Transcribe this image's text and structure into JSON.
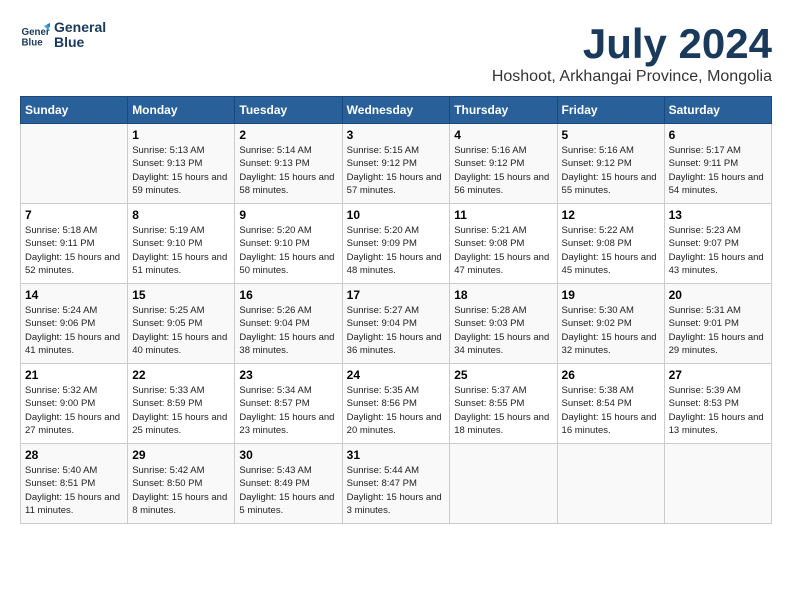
{
  "header": {
    "logo_line1": "General",
    "logo_line2": "Blue",
    "month_year": "July 2024",
    "location": "Hoshoot, Arkhangai Province, Mongolia"
  },
  "weekdays": [
    "Sunday",
    "Monday",
    "Tuesday",
    "Wednesday",
    "Thursday",
    "Friday",
    "Saturday"
  ],
  "weeks": [
    [
      {
        "day": "",
        "info": ""
      },
      {
        "day": "1",
        "info": "Sunrise: 5:13 AM\nSunset: 9:13 PM\nDaylight: 15 hours\nand 59 minutes."
      },
      {
        "day": "2",
        "info": "Sunrise: 5:14 AM\nSunset: 9:13 PM\nDaylight: 15 hours\nand 58 minutes."
      },
      {
        "day": "3",
        "info": "Sunrise: 5:15 AM\nSunset: 9:12 PM\nDaylight: 15 hours\nand 57 minutes."
      },
      {
        "day": "4",
        "info": "Sunrise: 5:16 AM\nSunset: 9:12 PM\nDaylight: 15 hours\nand 56 minutes."
      },
      {
        "day": "5",
        "info": "Sunrise: 5:16 AM\nSunset: 9:12 PM\nDaylight: 15 hours\nand 55 minutes."
      },
      {
        "day": "6",
        "info": "Sunrise: 5:17 AM\nSunset: 9:11 PM\nDaylight: 15 hours\nand 54 minutes."
      }
    ],
    [
      {
        "day": "7",
        "info": "Sunrise: 5:18 AM\nSunset: 9:11 PM\nDaylight: 15 hours\nand 52 minutes."
      },
      {
        "day": "8",
        "info": "Sunrise: 5:19 AM\nSunset: 9:10 PM\nDaylight: 15 hours\nand 51 minutes."
      },
      {
        "day": "9",
        "info": "Sunrise: 5:20 AM\nSunset: 9:10 PM\nDaylight: 15 hours\nand 50 minutes."
      },
      {
        "day": "10",
        "info": "Sunrise: 5:20 AM\nSunset: 9:09 PM\nDaylight: 15 hours\nand 48 minutes."
      },
      {
        "day": "11",
        "info": "Sunrise: 5:21 AM\nSunset: 9:08 PM\nDaylight: 15 hours\nand 47 minutes."
      },
      {
        "day": "12",
        "info": "Sunrise: 5:22 AM\nSunset: 9:08 PM\nDaylight: 15 hours\nand 45 minutes."
      },
      {
        "day": "13",
        "info": "Sunrise: 5:23 AM\nSunset: 9:07 PM\nDaylight: 15 hours\nand 43 minutes."
      }
    ],
    [
      {
        "day": "14",
        "info": "Sunrise: 5:24 AM\nSunset: 9:06 PM\nDaylight: 15 hours\nand 41 minutes."
      },
      {
        "day": "15",
        "info": "Sunrise: 5:25 AM\nSunset: 9:05 PM\nDaylight: 15 hours\nand 40 minutes."
      },
      {
        "day": "16",
        "info": "Sunrise: 5:26 AM\nSunset: 9:04 PM\nDaylight: 15 hours\nand 38 minutes."
      },
      {
        "day": "17",
        "info": "Sunrise: 5:27 AM\nSunset: 9:04 PM\nDaylight: 15 hours\nand 36 minutes."
      },
      {
        "day": "18",
        "info": "Sunrise: 5:28 AM\nSunset: 9:03 PM\nDaylight: 15 hours\nand 34 minutes."
      },
      {
        "day": "19",
        "info": "Sunrise: 5:30 AM\nSunset: 9:02 PM\nDaylight: 15 hours\nand 32 minutes."
      },
      {
        "day": "20",
        "info": "Sunrise: 5:31 AM\nSunset: 9:01 PM\nDaylight: 15 hours\nand 29 minutes."
      }
    ],
    [
      {
        "day": "21",
        "info": "Sunrise: 5:32 AM\nSunset: 9:00 PM\nDaylight: 15 hours\nand 27 minutes."
      },
      {
        "day": "22",
        "info": "Sunrise: 5:33 AM\nSunset: 8:59 PM\nDaylight: 15 hours\nand 25 minutes."
      },
      {
        "day": "23",
        "info": "Sunrise: 5:34 AM\nSunset: 8:57 PM\nDaylight: 15 hours\nand 23 minutes."
      },
      {
        "day": "24",
        "info": "Sunrise: 5:35 AM\nSunset: 8:56 PM\nDaylight: 15 hours\nand 20 minutes."
      },
      {
        "day": "25",
        "info": "Sunrise: 5:37 AM\nSunset: 8:55 PM\nDaylight: 15 hours\nand 18 minutes."
      },
      {
        "day": "26",
        "info": "Sunrise: 5:38 AM\nSunset: 8:54 PM\nDaylight: 15 hours\nand 16 minutes."
      },
      {
        "day": "27",
        "info": "Sunrise: 5:39 AM\nSunset: 8:53 PM\nDaylight: 15 hours\nand 13 minutes."
      }
    ],
    [
      {
        "day": "28",
        "info": "Sunrise: 5:40 AM\nSunset: 8:51 PM\nDaylight: 15 hours\nand 11 minutes."
      },
      {
        "day": "29",
        "info": "Sunrise: 5:42 AM\nSunset: 8:50 PM\nDaylight: 15 hours\nand 8 minutes."
      },
      {
        "day": "30",
        "info": "Sunrise: 5:43 AM\nSunset: 8:49 PM\nDaylight: 15 hours\nand 5 minutes."
      },
      {
        "day": "31",
        "info": "Sunrise: 5:44 AM\nSunset: 8:47 PM\nDaylight: 15 hours\nand 3 minutes."
      },
      {
        "day": "",
        "info": ""
      },
      {
        "day": "",
        "info": ""
      },
      {
        "day": "",
        "info": ""
      }
    ]
  ]
}
